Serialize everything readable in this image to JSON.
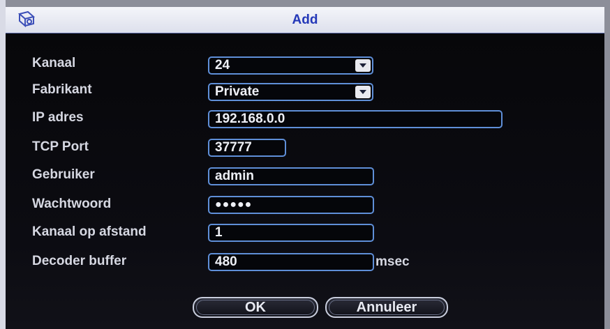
{
  "window": {
    "title": "Add",
    "icon": "network-device-icon"
  },
  "form": {
    "kanaal": {
      "label": "Kanaal",
      "value": "24"
    },
    "fabrikant": {
      "label": "Fabrikant",
      "value": "Private"
    },
    "ip": {
      "label": "IP adres",
      "value": "192.168.0.0"
    },
    "tcp_port": {
      "label": "TCP Port",
      "value": "37777"
    },
    "gebruiker": {
      "label": "Gebruiker",
      "value": "admin"
    },
    "wachtwoord": {
      "label": "Wachtwoord",
      "value": "●●●●●"
    },
    "kanaal_op_afstand": {
      "label": "Kanaal op afstand",
      "value": "1"
    },
    "decoder_buffer": {
      "label": "Decoder buffer",
      "value": "480",
      "unit": "msec"
    }
  },
  "buttons": {
    "ok": "OK",
    "cancel": "Annuleer"
  },
  "colors": {
    "title_text": "#2438b8",
    "field_border": "#5f8fd8",
    "background": "#07070a"
  }
}
